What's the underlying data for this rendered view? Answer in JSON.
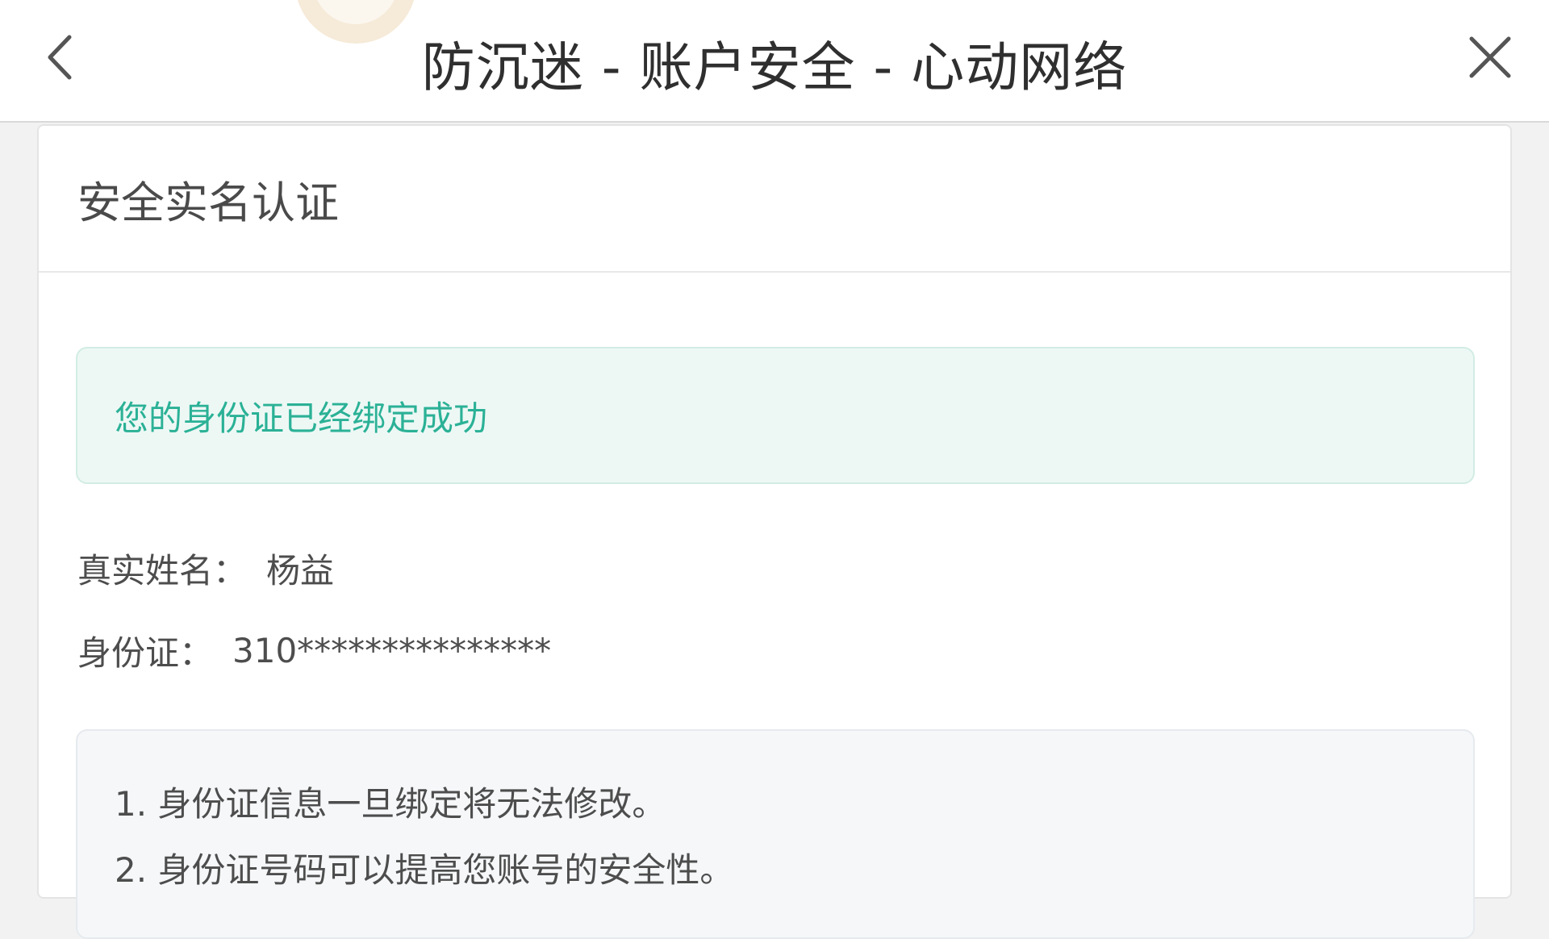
{
  "header": {
    "title": "防沉迷 - 账户安全 - 心动网络",
    "back_icon": "chevron-left-icon",
    "close_icon": "close-icon"
  },
  "card": {
    "title": "安全实名认证",
    "success_message": "您的身份证已经绑定成功",
    "fields": [
      {
        "label": "真实姓名：",
        "value": "杨益"
      },
      {
        "label": "身份证：",
        "value": "310***************"
      }
    ],
    "notes": [
      "1. 身份证信息一旦绑定将无法修改。",
      "2. 身份证号码可以提高您账号的安全性。"
    ]
  },
  "colors": {
    "accent_green": "#2bb196",
    "alert_bg": "#edf8f5",
    "notes_bg": "#f5f7f9"
  }
}
